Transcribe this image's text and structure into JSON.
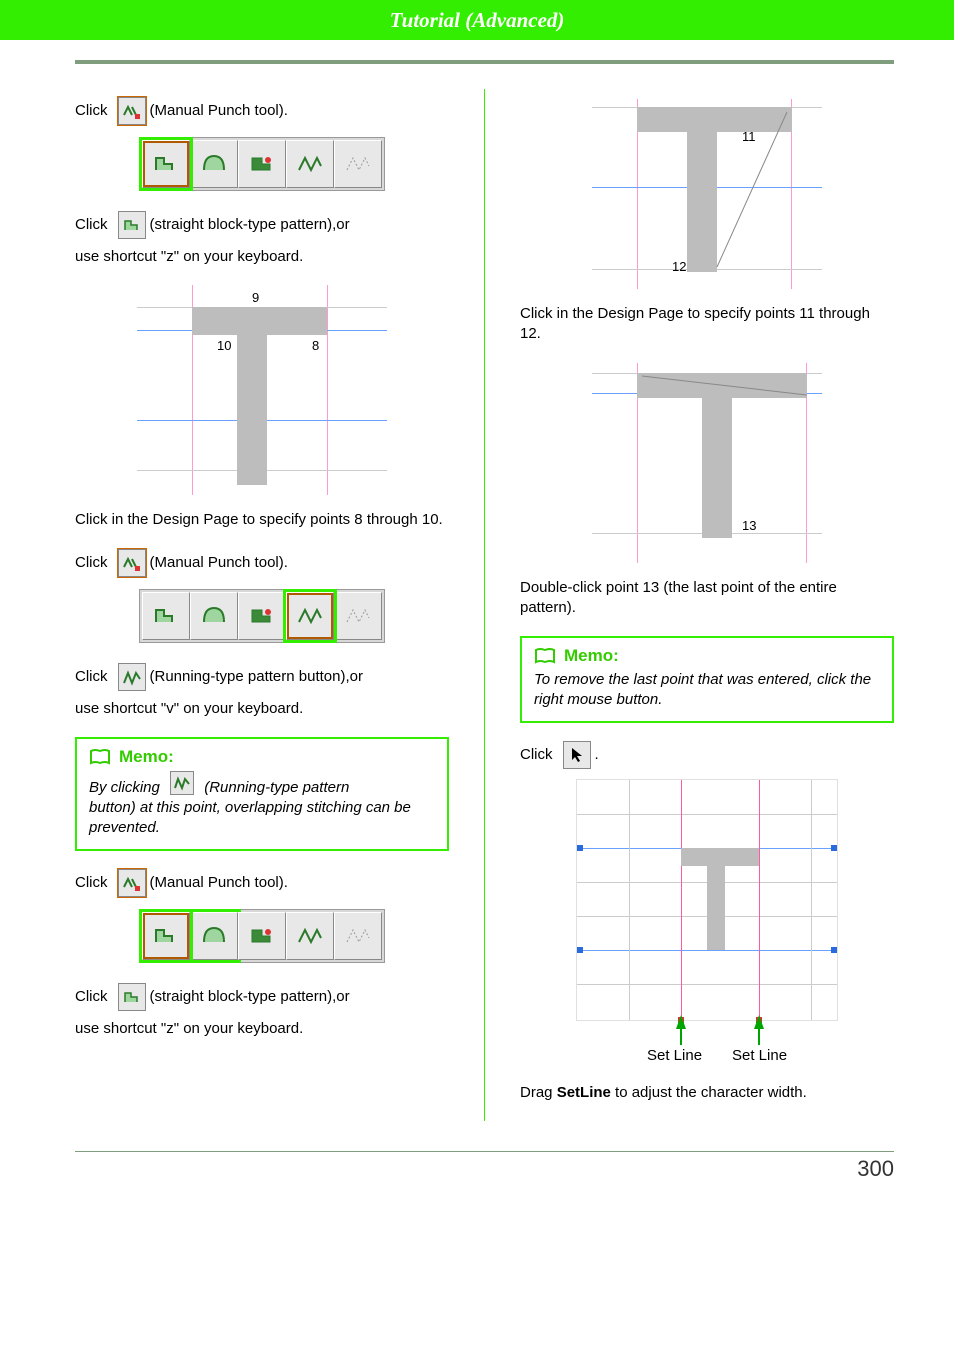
{
  "header": {
    "title": "Tutorial (Advanced)"
  },
  "icons": {
    "manual_punch": "manual-punch-icon",
    "straight_block": "straight-block-icon",
    "curve_block": "curve-block-icon",
    "running": "running-pattern-icon",
    "dotted": "dotted-pattern-icon",
    "pointer": "pointer-icon",
    "book": "book-icon"
  },
  "left": {
    "steps": [
      {
        "pre": "Click",
        "icon": "manual_punch",
        "post": "(Manual Punch tool)."
      },
      {
        "pre": "Click",
        "icon": "straight_block",
        "post": "(straight block-type pattern),or"
      },
      {
        "sub": "use shortcut \"z\" on your keyboard."
      }
    ],
    "diag1_labels": {
      "p8": "8",
      "p9": "9",
      "p10": "10"
    },
    "para1": "Click in the Design Page to specify points 8 through 10.",
    "steps2": [
      {
        "pre": "Click",
        "icon": "manual_punch",
        "post": "(Manual Punch tool)."
      },
      {
        "pre": "Click",
        "icon": "running",
        "post": "(Running-type pattern button),or"
      },
      {
        "sub": "use shortcut \"v\" on your keyboard."
      }
    ],
    "memo1": {
      "title": "Memo:",
      "body_pre": "By clicking",
      "body_mid": "(Running-type pattern",
      "body_rest": "button) at this point, overlapping stitching can be prevented."
    },
    "steps3": [
      {
        "pre": "Click",
        "icon": "manual_punch",
        "post": "(Manual Punch tool)."
      },
      {
        "pre": "Click",
        "icon": "straight_block",
        "post": "(straight block-type pattern),or"
      },
      {
        "sub": "use shortcut \"z\" on your keyboard."
      }
    ]
  },
  "right": {
    "diag2_labels": {
      "p11": "11",
      "p12": "12"
    },
    "para1": "Click in the Design Page to specify points 11 through 12.",
    "diag3_labels": {
      "p13": "13"
    },
    "para2": "Double-click point 13 (the last point of the entire pattern).",
    "memo2": {
      "title": "Memo:",
      "body": "To remove the last point that was entered, click the right mouse button."
    },
    "click_pointer": {
      "pre": "Click",
      "post": "."
    },
    "setline": {
      "left": "Set Line",
      "right": "Set Line"
    },
    "para3_pre": "Drag ",
    "para3_bold": "SetLine",
    "para3_post": " to adjust the character width."
  },
  "toolbars": {
    "tb_a": {
      "selected": 0
    },
    "tb_b": {
      "selected": 3
    },
    "tb_c": {
      "selected": 0,
      "overlap": 1
    }
  },
  "page_number": "300"
}
